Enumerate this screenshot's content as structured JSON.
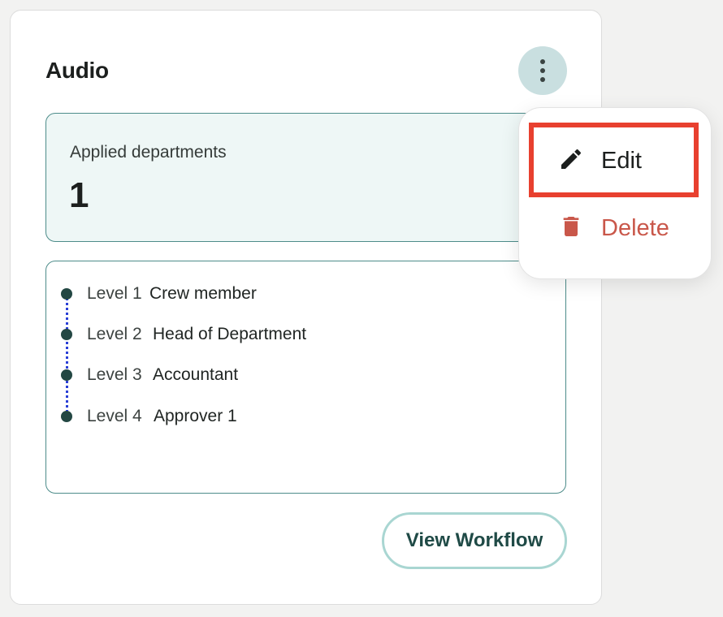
{
  "card": {
    "title": "Audio",
    "more_menu_icon": "more-vertical-icon"
  },
  "departments": {
    "label": "Applied departments",
    "count": "1"
  },
  "levels": [
    {
      "level": "Level 1",
      "role": "Crew member"
    },
    {
      "level": "Level 2",
      "role": "Head of Department"
    },
    {
      "level": "Level 3",
      "role": "Accountant"
    },
    {
      "level": "Level 4",
      "role": "Approver 1"
    }
  ],
  "actions": {
    "view_workflow_label": "View Workflow"
  },
  "context_menu": {
    "items": [
      {
        "label": "Edit",
        "icon": "pencil-icon"
      },
      {
        "label": "Delete",
        "icon": "trash-icon"
      }
    ],
    "highlighted_item": "Edit"
  },
  "colors": {
    "accent": "#234743",
    "timeline_dots": "#2a3fd6",
    "delete": "#c9574a",
    "highlight": "#e8402f",
    "dept_bg": "#eef7f6"
  }
}
